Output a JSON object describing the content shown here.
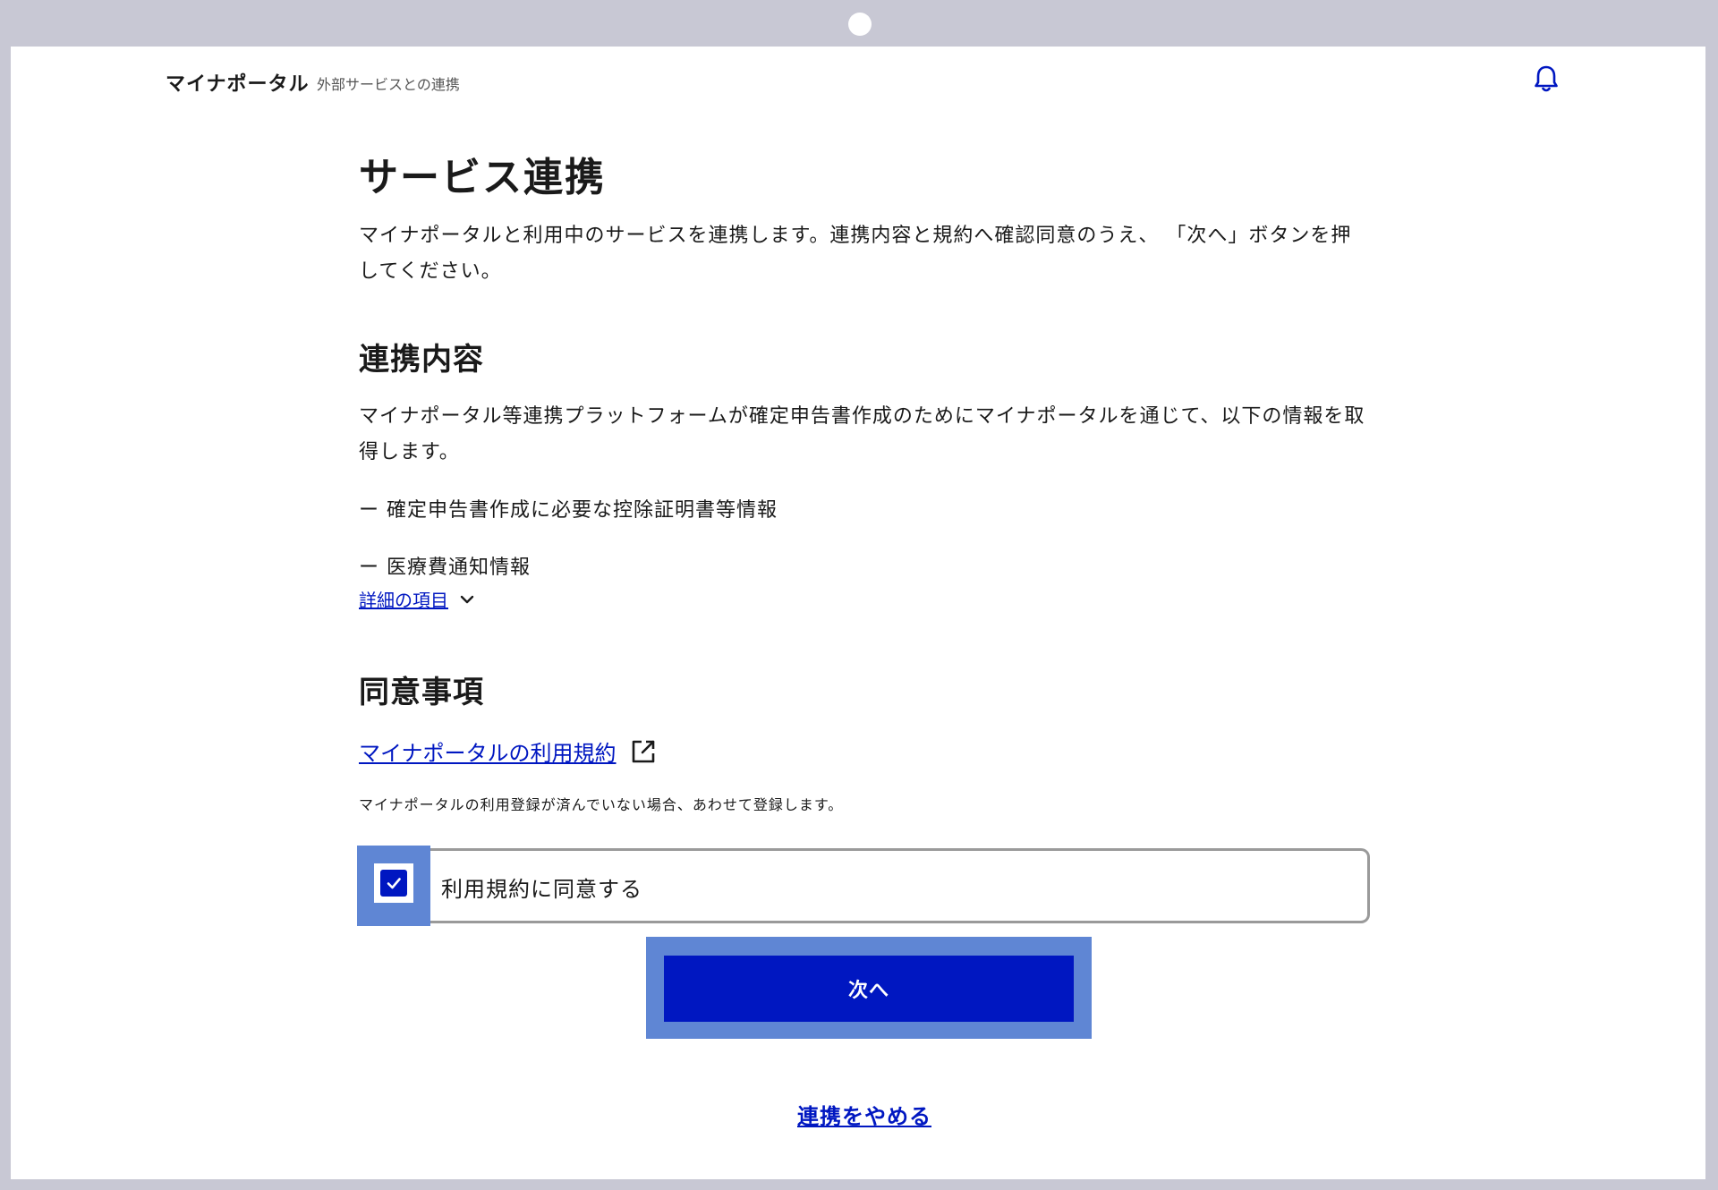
{
  "header": {
    "brand": "マイナポータル",
    "subtitle": "外部サービスとの連携",
    "bell_icon": "bell-icon"
  },
  "main": {
    "title": "サービス連携",
    "intro": "マイナポータルと利用中のサービスを連携します。連携内容と規約へ確認同意のうえ、 「次へ」ボタンを押してください。",
    "linkage": {
      "heading": "連携内容",
      "description": "マイナポータル等連携プラットフォームが確定申告書作成のためにマイナポータルを通じて、以下の情報を取得します。",
      "items": [
        "ー 確定申告書作成に必要な控除証明書等情報",
        "ー 医療費通知情報"
      ],
      "details_label": "詳細の項目"
    },
    "consent": {
      "heading": "同意事項",
      "terms_link": "マイナポータルの利用規約",
      "note": "マイナポータルの利用登録が済んでいない場合、あわせて登録します。",
      "checkbox_label": "利用規約に同意する",
      "checked": true
    },
    "next_button": "次へ",
    "cancel_link": "連携をやめる"
  },
  "colors": {
    "accent": "#0017c1",
    "highlight": "#5f86d4",
    "frame": "#c8c8d4"
  }
}
